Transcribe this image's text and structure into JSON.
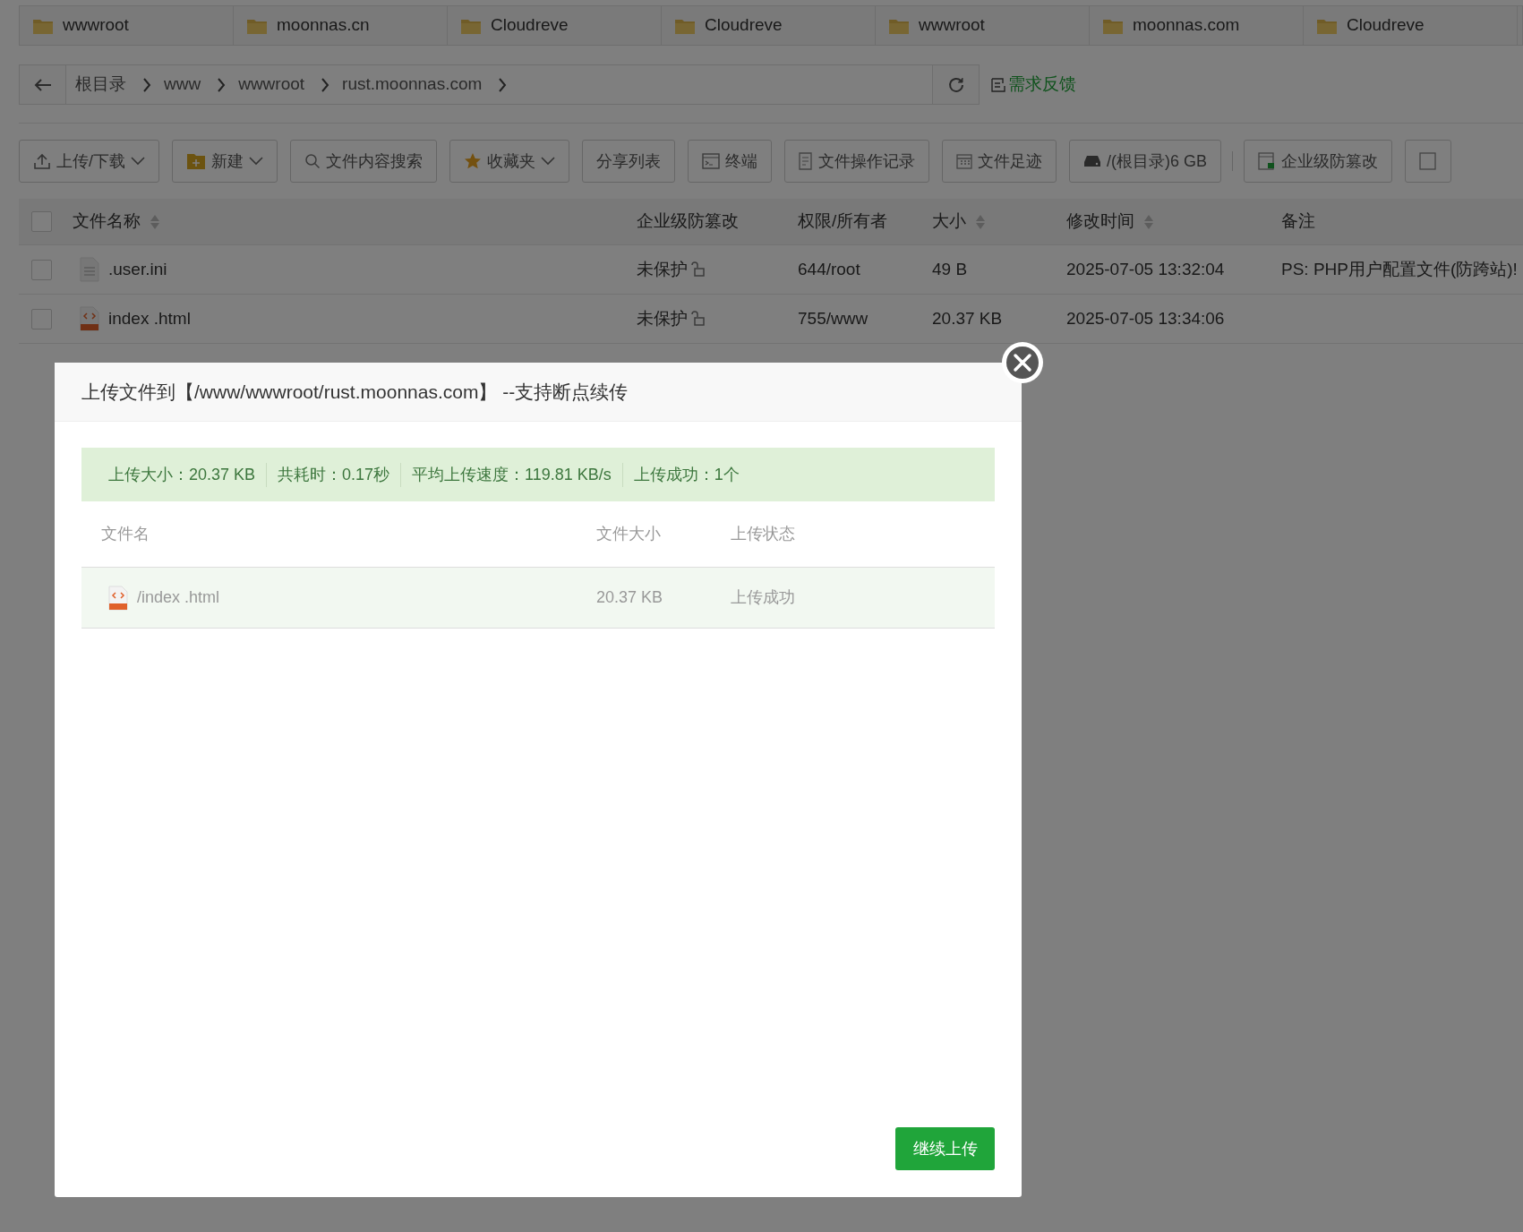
{
  "tabs": [
    {
      "label": "wwwroot"
    },
    {
      "label": "moonnas.cn"
    },
    {
      "label": "Cloudreve"
    },
    {
      "label": "Cloudreve"
    },
    {
      "label": "wwwroot"
    },
    {
      "label": "moonnas.com"
    },
    {
      "label": "Cloudreve"
    }
  ],
  "breadcrumb": {
    "segments": [
      "根目录",
      "www",
      "wwwroot",
      "rust.moonnas.com"
    ],
    "feedback": "需求反馈"
  },
  "toolbar": [
    {
      "kind": "upload",
      "label": "上传/下载",
      "dropdown": true
    },
    {
      "kind": "folder",
      "label": "新建",
      "dropdown": true
    },
    {
      "kind": "search",
      "label": "文件内容搜索",
      "dropdown": false
    },
    {
      "kind": "star",
      "label": "收藏夹",
      "dropdown": true
    },
    {
      "kind": "plain",
      "label": "分享列表",
      "dropdown": false
    },
    {
      "kind": "terminal",
      "label": "终端",
      "dropdown": false
    },
    {
      "kind": "log",
      "label": "文件操作记录",
      "dropdown": false
    },
    {
      "kind": "calendar",
      "label": "文件足迹",
      "dropdown": false
    },
    {
      "kind": "disk",
      "label": "/(根目录)6 GB",
      "dropdown": false
    },
    {
      "kind": "shield",
      "label": "企业级防篡改",
      "dropdown": false
    },
    {
      "kind": "image",
      "dropdown": false
    }
  ],
  "table": {
    "all_checked": false,
    "columns": [
      {
        "label": "文件名称",
        "sortable": true
      },
      {
        "label": "企业级防篡改",
        "sortable": false
      },
      {
        "label": "权限/所有者",
        "sortable": false
      },
      {
        "label": "大小",
        "sortable": true
      },
      {
        "label": "修改时间",
        "sortable": true
      },
      {
        "label": "备注",
        "sortable": false
      }
    ],
    "rows": [
      {
        "checked": false,
        "kind": "text",
        "name": ".user.ini",
        "protection": "未保护",
        "permission": "644/root",
        "size": "49 B",
        "modified": "2025-07-05 13:32:04",
        "note": "PS: PHP用户配置文件(防跨站)!"
      },
      {
        "checked": false,
        "kind": "html",
        "name": "index .html",
        "protection": "未保护",
        "permission": "755/www",
        "size": "20.37 KB",
        "modified": "2025-07-05 13:34:06"
      }
    ]
  },
  "dialog": {
    "title": "上传文件到【/www/wwwroot/rust.moonnas.com】 --支持断点续传",
    "summary": [
      "上传大小：20.37 KB",
      "共耗时：0.17秒",
      "平均上传速度：119.81 KB/s",
      "上传成功：1个"
    ],
    "columns": [
      "文件名",
      "文件大小",
      "上传状态"
    ],
    "rows": [
      {
        "kind": "html",
        "name": "/index .html",
        "size": "20.37 KB",
        "status": "上传成功"
      }
    ],
    "button": "继续上传"
  }
}
